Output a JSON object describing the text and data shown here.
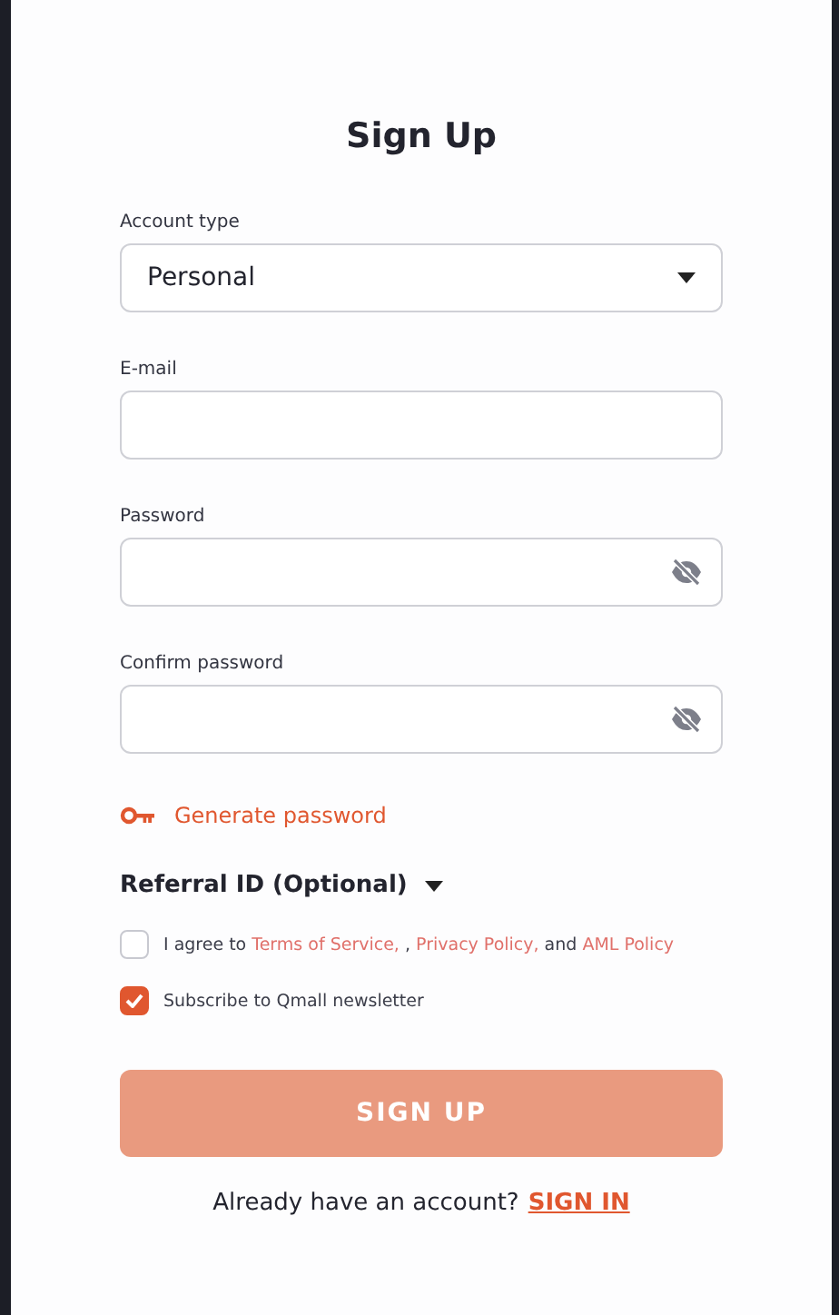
{
  "title": "Sign Up",
  "fields": [
    {
      "kind": "select",
      "label": "Account type",
      "value": "Personal"
    },
    {
      "kind": "text",
      "label": "E-mail"
    },
    {
      "kind": "password",
      "label": "Password"
    },
    {
      "kind": "password",
      "label": "Confirm password"
    }
  ],
  "generate_link": "Generate password",
  "referral": {
    "label": "Referral ID (Optional)",
    "expanded": false
  },
  "checkboxes": [
    {
      "checked": false,
      "parts": [
        {
          "text": "I agree to ",
          "link": false
        },
        {
          "text": "Terms of Service,",
          "link": true
        },
        {
          "text": " , ",
          "link": false
        },
        {
          "text": "Privacy Policy,",
          "link": true
        },
        {
          "text": " and ",
          "link": false
        },
        {
          "text": "AML Policy",
          "link": true
        }
      ]
    },
    {
      "checked": true,
      "parts": [
        {
          "text": "Subscribe to Qmall newsletter",
          "link": false
        }
      ]
    }
  ],
  "submit": {
    "label": "SIGN UP",
    "disabled": true
  },
  "signin": {
    "text": "Already have an account?",
    "link": "SIGN IN"
  }
}
